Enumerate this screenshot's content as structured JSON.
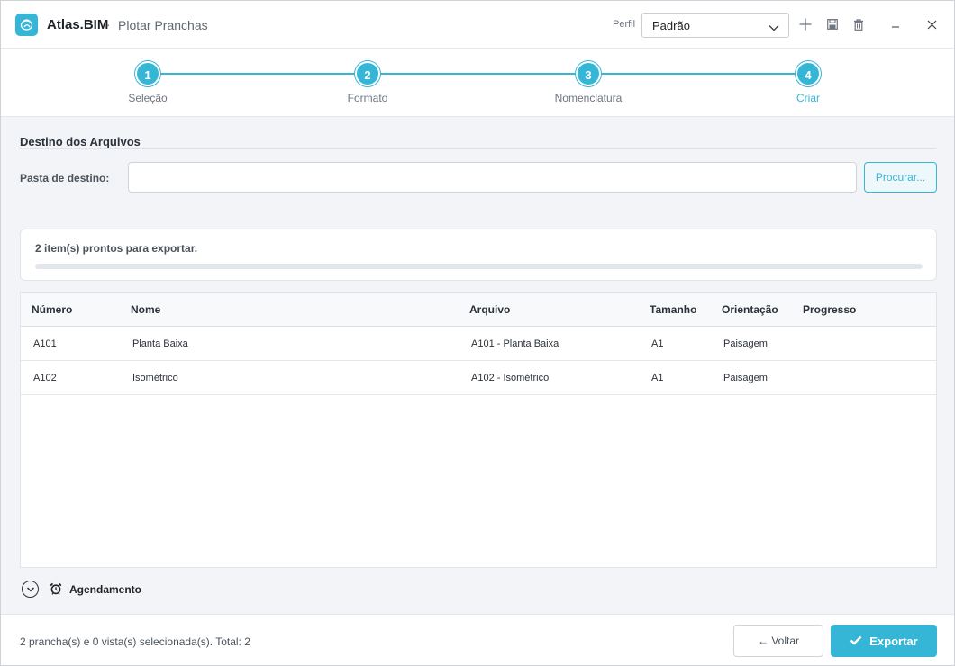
{
  "app": {
    "name": "Atlas.BIM",
    "separator": "·",
    "subtitle": "Plotar Pranchas"
  },
  "perfil": {
    "label": "Perfil",
    "selected": "Padrão"
  },
  "stepper": {
    "steps": [
      {
        "number": "1",
        "label": "Seleção"
      },
      {
        "number": "2",
        "label": "Formato"
      },
      {
        "number": "3",
        "label": "Nomenclatura"
      },
      {
        "number": "4",
        "label": "Criar"
      }
    ],
    "active_step": 4
  },
  "destino": {
    "section_title": "Destino dos Arquivos",
    "folder_label": "Pasta de destino:",
    "folder_value": "",
    "browse_label": "Procurar..."
  },
  "status": {
    "text": "2 item(s) prontos para exportar.",
    "progress": 0
  },
  "table": {
    "columns": [
      "Número",
      "Nome",
      "Arquivo",
      "Tamanho",
      "Orientação",
      "Progresso"
    ],
    "rows": [
      {
        "numero": "A101",
        "nome": "Planta Baixa",
        "arquivo": "A101 - Planta Baixa",
        "tamanho": "A1",
        "orientacao": "Paisagem",
        "progresso": ""
      },
      {
        "numero": "A102",
        "nome": "Isométrico",
        "arquivo": "A102 - Isométrico",
        "tamanho": "A1",
        "orientacao": "Paisagem",
        "progresso": ""
      }
    ]
  },
  "agendamento": {
    "label": "Agendamento"
  },
  "footer": {
    "summary": "2 prancha(s) e 0 vista(s) selecionada(s). Total: 2",
    "back_label": "← Voltar",
    "export_label": "Exportar"
  },
  "colors": {
    "accent": "#36b6d6",
    "background": "#f2f4f7"
  }
}
